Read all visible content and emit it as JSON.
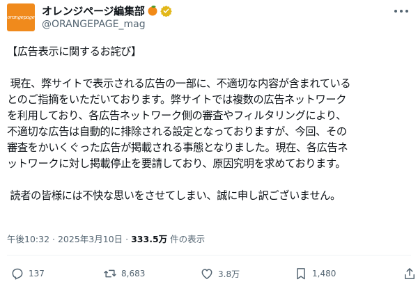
{
  "account": {
    "display_name": "オレンジページ編集部",
    "handle": "@ORANGEPAGE_mag",
    "avatar_text": "orangepage",
    "brand_color": "#f08a1c",
    "verified_color": "#e2b719"
  },
  "post": {
    "paragraphs": [
      [
        "【広告表示に関するお詫び】"
      ],
      [
        "現在、弊サイトで表示される広告の一部に、不適切な内容が含まれている",
        "とのご指摘をいただいております。弊サイトでは複数の広告ネットワーク",
        "を利用しており、各広告ネットワーク側の審査やフィルタリングにより、",
        "不適切な広告は自動的に排除される設定となっておりますが、今回、その",
        "審査をかいくぐった広告が掲載される事態となりました。現在、各広告ネ",
        "ットワークに対し掲載停止を要請しており、原因究明を求めております。"
      ],
      [
        "読者の皆様には不快な思いをさせてしまい、誠に申し訳ございません。"
      ]
    ],
    "time": "午後10:32",
    "separator": "·",
    "date": "2025年3月10日",
    "view_count": "333.5万",
    "view_label": "件の表示"
  },
  "actions": {
    "replies": "137",
    "reposts": "8,683",
    "likes": "3.8万",
    "bookmarks": "1,480"
  },
  "icons": {
    "avatar": "orangepage-logo",
    "emoji": "tangerine-icon",
    "badge": "verified-badge-icon",
    "more": "more-icon",
    "reply": "reply-icon",
    "repost": "repost-icon",
    "like": "heart-icon",
    "bookmark": "bookmark-icon",
    "share": "share-icon"
  }
}
